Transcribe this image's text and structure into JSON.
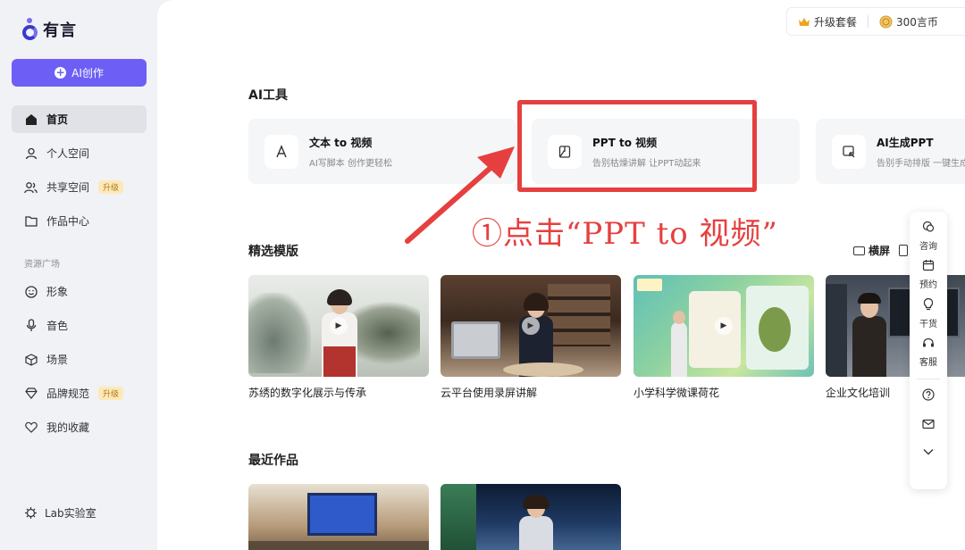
{
  "app": {
    "logo_text": "有言"
  },
  "sidebar": {
    "create_label": "AI创作",
    "items": [
      {
        "label": "首页",
        "icon": "home-icon",
        "active": true
      },
      {
        "label": "个人空间",
        "icon": "user-icon"
      },
      {
        "label": "共享空间",
        "icon": "users-icon",
        "badge": "升级"
      },
      {
        "label": "作品中心",
        "icon": "folder-icon"
      }
    ],
    "section_label": "资源广场",
    "resource_items": [
      {
        "label": "形象",
        "icon": "face-icon"
      },
      {
        "label": "音色",
        "icon": "mic-icon"
      },
      {
        "label": "场景",
        "icon": "cube-icon"
      },
      {
        "label": "品牌规范",
        "icon": "diamond-icon",
        "badge": "升级"
      },
      {
        "label": "我的收藏",
        "icon": "heart-icon"
      }
    ],
    "lab_label": "Lab实验室"
  },
  "topbar": {
    "upgrade_label": "升级套餐",
    "coins_label": "300言币"
  },
  "ai_tools": {
    "heading": "AI工具",
    "cards": [
      {
        "title": "文本 to 视频",
        "subtitle": "AI写脚本 创作更轻松",
        "icon": "text-a-icon"
      },
      {
        "title": "PPT to 视频",
        "subtitle": "告别枯燥讲解 让PPT动起来",
        "icon": "ppt-icon"
      },
      {
        "title": "AI生成PPT",
        "subtitle": "告别手动排版 一键生成",
        "icon": "ai-ppt-icon"
      }
    ]
  },
  "templates": {
    "heading": "精选模版",
    "view_landscape": "横屏",
    "items": [
      {
        "label": "苏绣的数字化展示与传承"
      },
      {
        "label": "云平台使用录屏讲解"
      },
      {
        "label": "小学科学微课荷花"
      },
      {
        "label": "企业文化培训"
      }
    ]
  },
  "recent": {
    "heading": "最近作品"
  },
  "annotation": {
    "text": "①点击“PPT to 视频”"
  },
  "float_bar": {
    "items": [
      {
        "label": "咨询",
        "icon": "chat-icon"
      },
      {
        "label": "预约",
        "icon": "calendar-icon"
      },
      {
        "label": "干货",
        "icon": "bulb-icon"
      },
      {
        "label": "客服",
        "icon": "headset-icon"
      }
    ]
  },
  "colors": {
    "accent": "#6d5ff5",
    "annotation": "#e5403f",
    "badge_bg": "#fde9b8"
  }
}
